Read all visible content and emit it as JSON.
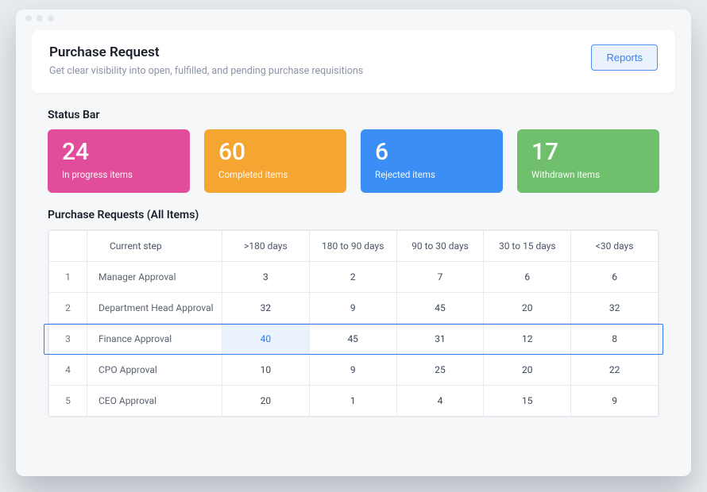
{
  "header": {
    "title": "Purchase Request",
    "subtitle": "Get clear visibility into open, fulfilled, and pending purchase requisitions",
    "reports_label": "Reports"
  },
  "status_bar": {
    "label": "Status Bar",
    "cards": [
      {
        "value": "24",
        "label": "In progress items",
        "color": "pink"
      },
      {
        "value": "60",
        "label": "Completed items",
        "color": "orange"
      },
      {
        "value": "6",
        "label": "Rejected items",
        "color": "blue"
      },
      {
        "value": "17",
        "label": "Withdrawn items",
        "color": "green"
      }
    ]
  },
  "table": {
    "title": "Purchase Requests (All Items)",
    "columns": [
      "Current step",
      ">180 days",
      "180 to 90 days",
      "90 to 30 days",
      "30 to 15 days",
      "<30 days"
    ],
    "rows": [
      {
        "idx": "1",
        "step": "Manager Approval",
        "cells": [
          "3",
          "2",
          "7",
          "6",
          "6"
        ]
      },
      {
        "idx": "2",
        "step": "Department Head Approval",
        "cells": [
          "32",
          "9",
          "45",
          "20",
          "32"
        ]
      },
      {
        "idx": "3",
        "step": "Finance Approval",
        "cells": [
          "40",
          "45",
          "31",
          "12",
          "8"
        ],
        "highlight": true,
        "highlight_col": 0
      },
      {
        "idx": "4",
        "step": "CPO Approval",
        "cells": [
          "10",
          "9",
          "25",
          "20",
          "22"
        ]
      },
      {
        "idx": "5",
        "step": "CEO Approval",
        "cells": [
          "20",
          "1",
          "4",
          "15",
          "9"
        ]
      }
    ]
  }
}
